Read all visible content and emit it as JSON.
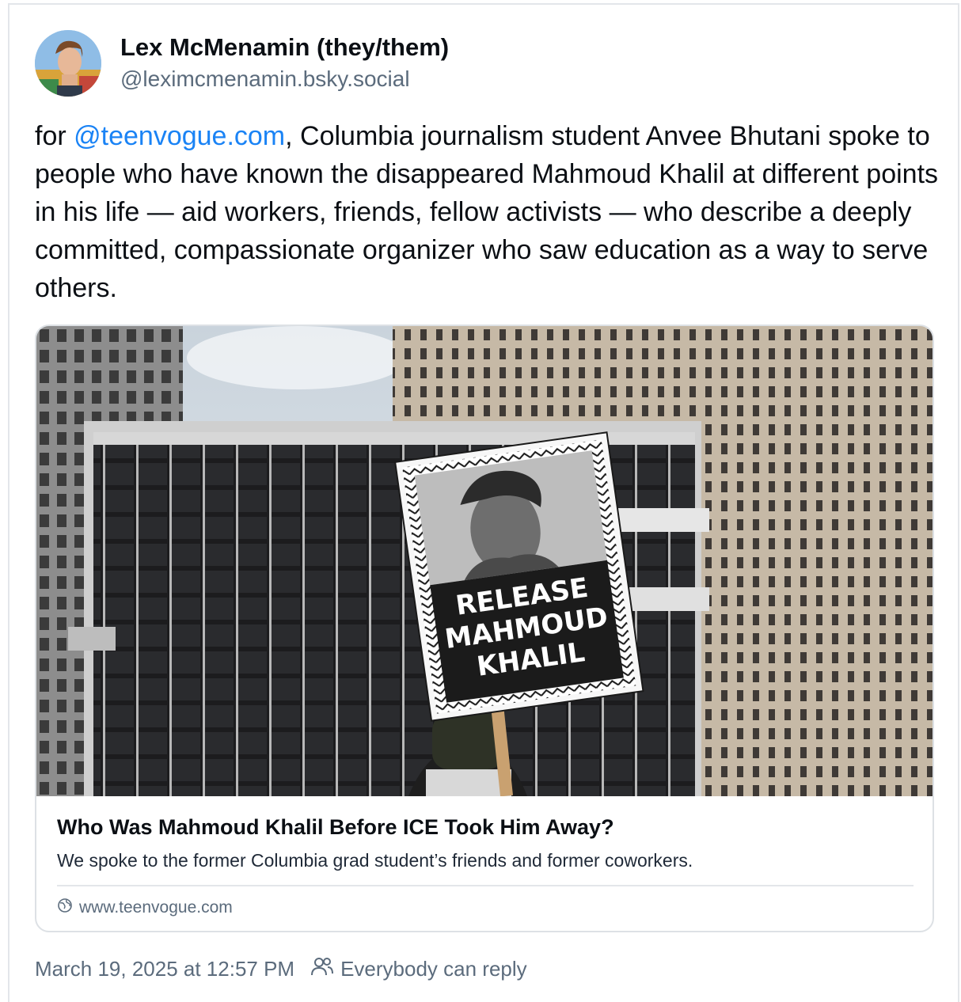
{
  "post": {
    "author_name": "Lex McMenamin (they/them)",
    "author_handle": "@leximcmenamin.bsky.social",
    "text_before_mention": "for ",
    "mention": "@teenvogue.com",
    "text_after_mention": ", Columbia journalism student Anvee Bhutani spoke to people who have known the disappeared Mahmoud Khalil at different points in his life — aid workers, friends, fellow activists — who describe a deeply committed, compassionate organizer who saw education as a way to serve others.",
    "timestamp": "March 19, 2025 at 12:57 PM",
    "reply_setting": "Everybody can reply"
  },
  "link_card": {
    "sign_text": [
      "RELEASE",
      "MAHMOUD",
      "KHALIL"
    ],
    "title": "Who Was Mahmoud Khalil Before ICE Took Him Away?",
    "description": "We spoke to the former Columbia grad student’s friends and former coworkers.",
    "domain": "www.teenvogue.com"
  },
  "icons": {
    "globe": "globe-icon",
    "people": "people-icon"
  },
  "colors": {
    "mention": "#1a83f5",
    "muted": "#5b6b7c",
    "border": "#dde1e5"
  }
}
